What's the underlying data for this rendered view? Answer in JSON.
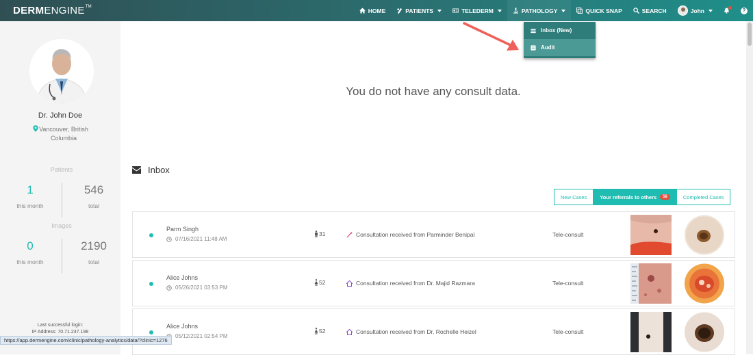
{
  "brand": {
    "bold": "DERM",
    "light": "ENGINE",
    "tm": "TM"
  },
  "nav": {
    "home": "HOME",
    "patients": "PATIENTS",
    "telederm": "TELEDERM",
    "pathology": "PATHOLOGY",
    "quick_snap": "QUICK SNAP",
    "search": "SEARCH",
    "user": "John",
    "help": "?"
  },
  "pathology_menu": {
    "items": [
      {
        "label": "Inbox (New)",
        "icon": "inbox-icon"
      },
      {
        "label": "Audit",
        "icon": "audit-icon"
      }
    ]
  },
  "profile": {
    "name": "Dr. John Doe",
    "location": "Vancouver, British Columbia"
  },
  "stats": {
    "patients_label": "Patients",
    "patients_month": "1",
    "patients_month_cap": "this month",
    "patients_total": "546",
    "patients_total_cap": "total",
    "images_label": "Images",
    "images_month": "0",
    "images_month_cap": "this month",
    "images_total": "2190",
    "images_total_cap": "total"
  },
  "last_login": {
    "label": "Last successful login:",
    "ip": "IP Address: 70.71.247.198"
  },
  "main": {
    "empty_message": "You do not have any consult data.",
    "inbox_title": "Inbox",
    "tabs": [
      {
        "label": "New Cases"
      },
      {
        "label": "Your referrals to others",
        "count": "58"
      },
      {
        "label": "Completed Cases"
      }
    ],
    "rows": [
      {
        "name": "Parm Singh",
        "date": "07/16/2021 11:48 AM",
        "age": "31",
        "gender": "male",
        "consult": "Consultation received from Parminder Benipal",
        "type": "Tele-consult"
      },
      {
        "name": "Alice Johns",
        "date": "05/26/2021 03:53 PM",
        "age": "52",
        "gender": "female",
        "consult": "Consultation received from Dr. Majid Razmara",
        "type": "Tele-consult"
      },
      {
        "name": "Alice Johns",
        "date": "05/12/2021 02:54 PM",
        "age": "52",
        "gender": "female",
        "consult": "Consultation received from Dr. Rochelle Heizel",
        "type": "Tele-consult"
      }
    ]
  },
  "status_url": "https://app.dermengine.com/clinic/pathology-analytics/data/?clinic=1276",
  "colors": {
    "accent": "#1fbdb1",
    "nav": "#2b6f71",
    "badge": "#e74c3c",
    "arrow": "#f0605a"
  }
}
